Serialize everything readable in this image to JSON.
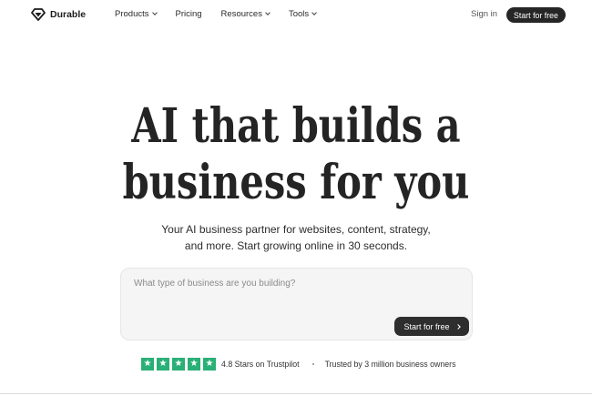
{
  "brand": {
    "name": "Durable",
    "logo_icon": "durable-diamond-logo"
  },
  "nav": {
    "links": [
      {
        "label": "Products",
        "has_dropdown": true
      },
      {
        "label": "Pricing",
        "has_dropdown": false
      },
      {
        "label": "Resources",
        "has_dropdown": true
      },
      {
        "label": "Tools",
        "has_dropdown": true
      }
    ],
    "signin_label": "Sign in",
    "cta_label": "Start for free"
  },
  "hero": {
    "headline_line1": "AI that builds a",
    "headline_line2": "business for you",
    "subtitle_line1": "Your AI business partner for websites, content, strategy,",
    "subtitle_line2": "and more. Start growing online in 30 seconds."
  },
  "prompt": {
    "placeholder": "What type of business are you building?",
    "value": "",
    "cta_label": "Start for free",
    "cta_icon": "chevron-right-icon"
  },
  "trust": {
    "star_count": 5,
    "rating_text": "4.8 Stars on Trustpilot",
    "trusted_text": "Trusted by 3 million business owners",
    "star_color": "#29b076"
  },
  "colors": {
    "primary_button": "#262626",
    "text": "#1c1c1c",
    "prompt_background": "#f5f5f5"
  }
}
